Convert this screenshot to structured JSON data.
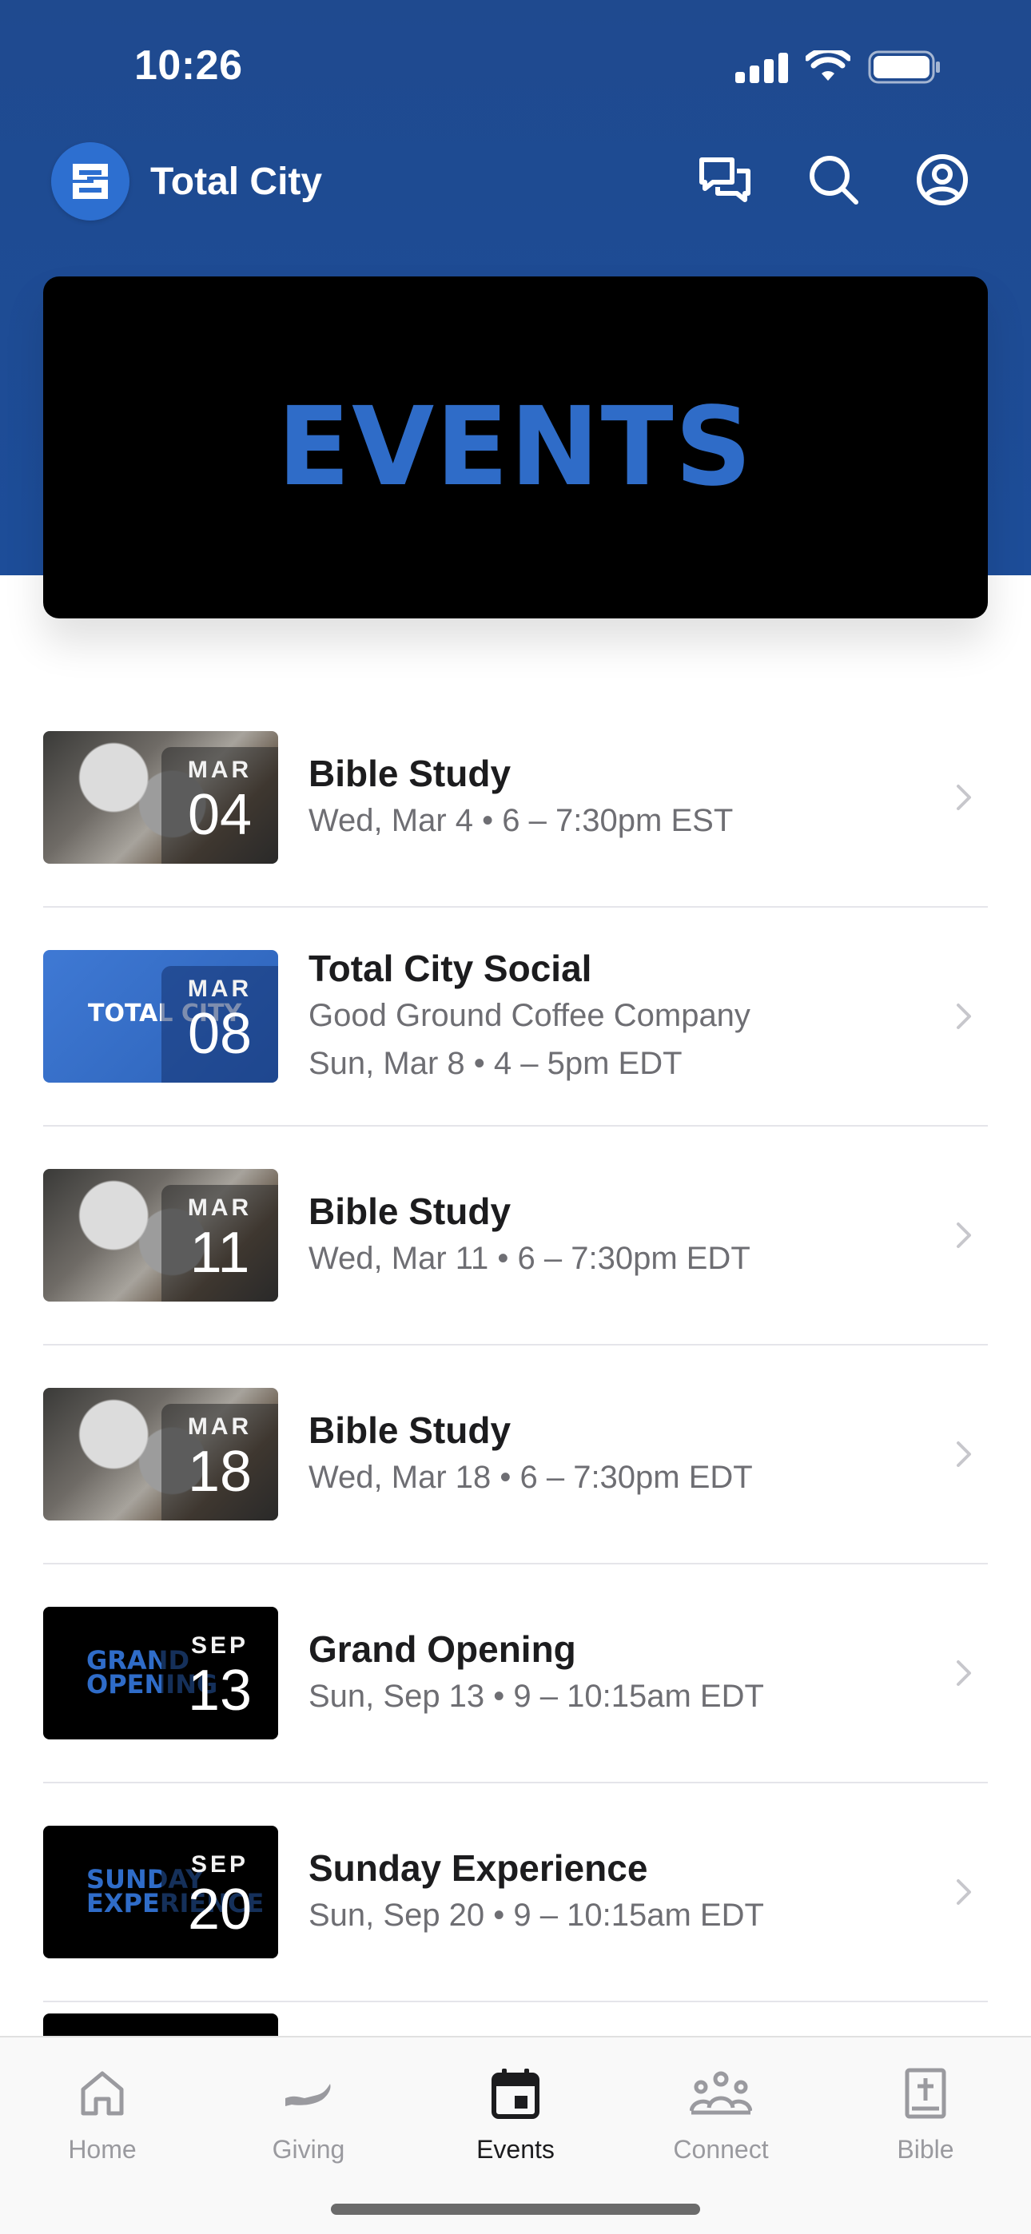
{
  "status_bar": {
    "time": "10:26"
  },
  "header": {
    "app_name": "Total City",
    "icons": [
      "chat-icon",
      "search-icon",
      "profile-icon"
    ]
  },
  "hero": {
    "title": "EVENTS"
  },
  "events": [
    {
      "title": "Bible Study",
      "lines": [
        "Wed, Mar 4 • 6 – 7:30pm EST"
      ],
      "month": "MAR",
      "day": "04",
      "thumb": "photo"
    },
    {
      "title": "Total City Social",
      "lines": [
        "Good Ground Coffee Company",
        "Sun, Mar 8 • 4 – 5pm EDT"
      ],
      "month": "MAR",
      "day": "08",
      "thumb": "social",
      "thumb_text": "TOTAL CITY"
    },
    {
      "title": "Bible Study",
      "lines": [
        "Wed, Mar 11 • 6 – 7:30pm EDT"
      ],
      "month": "MAR",
      "day": "11",
      "thumb": "photo"
    },
    {
      "title": "Bible Study",
      "lines": [
        "Wed, Mar 18 • 6 – 7:30pm EDT"
      ],
      "month": "MAR",
      "day": "18",
      "thumb": "photo"
    },
    {
      "title": "Grand Opening",
      "lines": [
        "Sun, Sep 13 • 9 – 10:15am EDT"
      ],
      "month": "SEP",
      "day": "13",
      "thumb": "black",
      "thumb_text_1": "GRAND",
      "thumb_text_2": "OPENING"
    },
    {
      "title": "Sunday Experience",
      "lines": [
        "Sun, Sep 20 • 9 – 10:15am EDT"
      ],
      "month": "SEP",
      "day": "20",
      "thumb": "black",
      "thumb_text_1": "SUNDAY",
      "thumb_text_2": "EXPERIENCE"
    }
  ],
  "tabbar": {
    "tabs": [
      {
        "label": "Home",
        "icon": "home-icon",
        "active": false
      },
      {
        "label": "Giving",
        "icon": "giving-hand-icon",
        "active": false
      },
      {
        "label": "Events",
        "icon": "calendar-icon",
        "active": true
      },
      {
        "label": "Connect",
        "icon": "people-icon",
        "active": false
      },
      {
        "label": "Bible",
        "icon": "bible-icon",
        "active": false
      }
    ]
  },
  "colors": {
    "brand_blue": "#1f4a8f",
    "accent_blue": "#2f6cc8",
    "text_primary": "#1c1c1e",
    "text_secondary": "#6e6e73"
  }
}
